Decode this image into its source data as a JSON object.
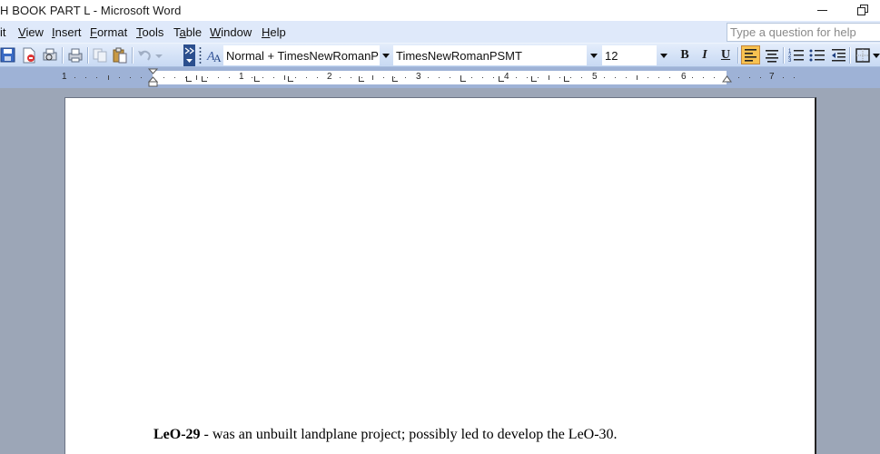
{
  "window": {
    "title": "H BOOK PART L - Microsoft Word"
  },
  "menu": {
    "items": [
      {
        "pre": "",
        "key": "",
        "post": "it"
      },
      {
        "pre": "",
        "key": "V",
        "post": "iew"
      },
      {
        "pre": "",
        "key": "I",
        "post": "nsert"
      },
      {
        "pre": "",
        "key": "F",
        "post": "ormat"
      },
      {
        "pre": "",
        "key": "T",
        "post": "ools"
      },
      {
        "pre": "T",
        "key": "a",
        "post": "ble"
      },
      {
        "pre": "",
        "key": "W",
        "post": "indow"
      },
      {
        "pre": "",
        "key": "H",
        "post": "elp"
      }
    ],
    "help_placeholder": "Type a question for help"
  },
  "toolbar": {
    "style_value": "Normal + TimesNewRomanPSM",
    "font_value": "TimesNewRomanPSMT",
    "size_value": "12",
    "bold_label": "B",
    "italic_label": "I",
    "underline_label": "U"
  },
  "ruler": {
    "numbers": [
      "1",
      "1",
      "2",
      "3",
      "4",
      "5",
      "6",
      "7"
    ]
  },
  "document": {
    "term": "LeO-29",
    "rest": " - was an unbuilt landplane project; possibly led to develop the LeO-30."
  },
  "colors": {
    "menubar": "#dfe9fa",
    "toolbar_gradient_top": "#e4edfb",
    "toolbar_gradient_bottom": "#c7d9f3",
    "ruler_margin": "#9eb2d6",
    "workspace": "#9ca6b7",
    "active_button": "#f7c251"
  }
}
